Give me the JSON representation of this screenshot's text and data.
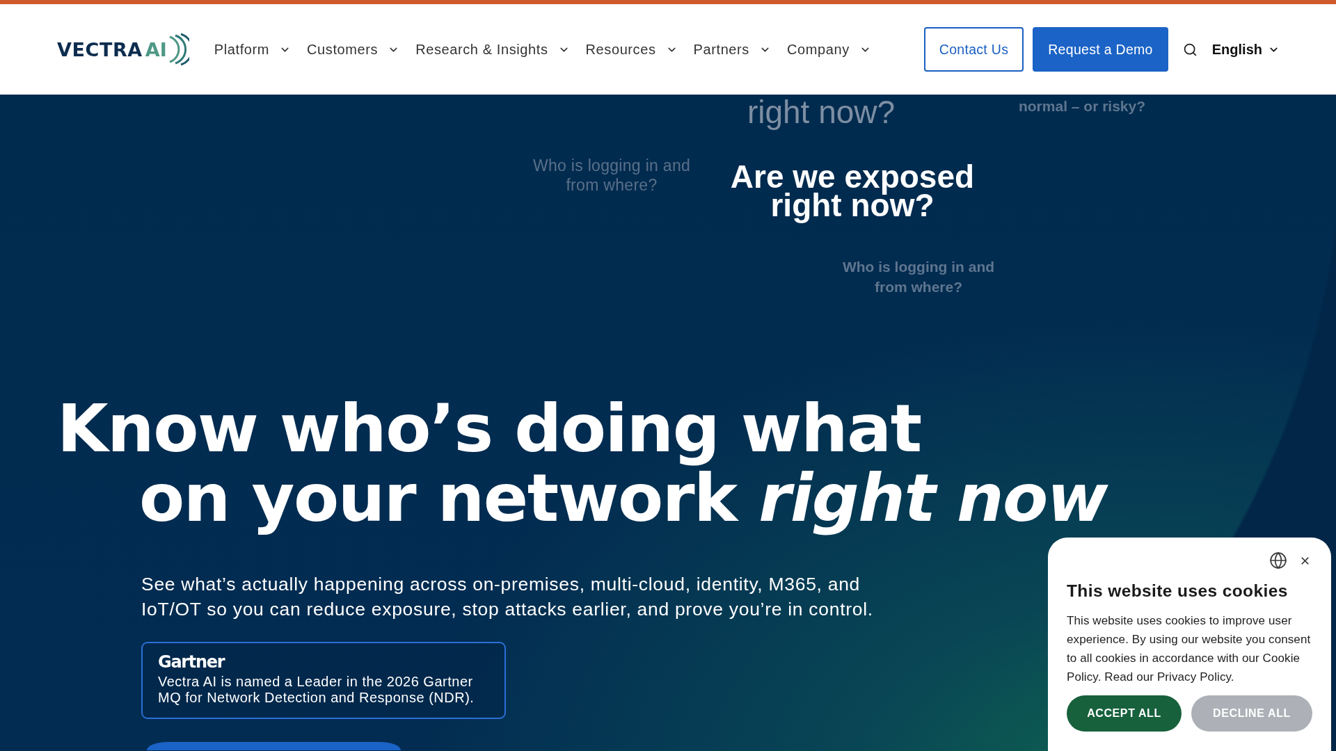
{
  "header": {
    "logo": {
      "wordmark": "VECTRA",
      "mark": "AI"
    },
    "nav": [
      "Platform",
      "Customers",
      "Research & Insights",
      "Resources",
      "Partners",
      "Company"
    ],
    "buttons": [
      {
        "label": "Contact Us",
        "kind": "outline"
      },
      {
        "label": "Request a Demo",
        "kind": "solid"
      }
    ],
    "language": "English"
  },
  "hero": {
    "questions": [
      {
        "text": "right now?",
        "kind": "fading"
      },
      {
        "text": "normal – or risky?",
        "kind": "muted"
      },
      {
        "text": "Who is logging in and from where?",
        "kind": "faint"
      },
      {
        "text": "Are we exposed right now?",
        "kind": "focus"
      },
      {
        "text": "Who is logging in and from where?",
        "kind": "muted"
      }
    ],
    "headline": [
      "Know who’s doing what",
      "on your network *right now*"
    ],
    "subtext": "See what’s actually happening across on-premises, multi-cloud, identity, M365, and IoT/OT so you can reduce exposure, stop attacks earlier, and prove you’re in control.",
    "award": {
      "brand": "Gartner",
      "text": "Vectra AI is named a Leader in the 2026 Gartner MQ for Network Detection and Response (NDR)."
    }
  },
  "cookie_banner": {
    "title": "This website uses cookies",
    "text": "This website uses cookies to improve user experience. By using our website you consent to all cookies in accordance with our Cookie Policy. Read our Privacy Policy.",
    "buttons": [
      {
        "label": "ACCEPT ALL",
        "kind": "primary"
      },
      {
        "label": "DECLINE ALL",
        "kind": "secondary"
      }
    ]
  }
}
